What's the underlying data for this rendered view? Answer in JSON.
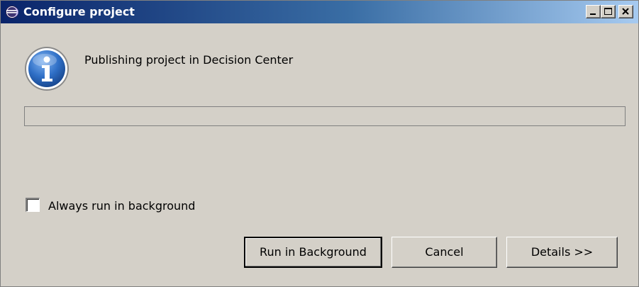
{
  "window": {
    "title": "Configure project",
    "icon": "eclipse-icon"
  },
  "titlebar_buttons": {
    "minimize_icon": "minimize-icon",
    "maximize_icon": "maximize-icon",
    "close_icon": "close-icon"
  },
  "dialog": {
    "message_icon": "info-icon",
    "message": "Publishing project in Decision Center",
    "progress_fraction": 0
  },
  "options": {
    "always_background_label": "Always run in background",
    "always_background_checked": false
  },
  "buttons": {
    "run_in_background": "Run in Background",
    "cancel": "Cancel",
    "details": "Details >>"
  },
  "colors": {
    "titlebar_start": "#0a246a",
    "titlebar_end": "#a6caf0",
    "dialog_background": "#d4d0c8"
  }
}
